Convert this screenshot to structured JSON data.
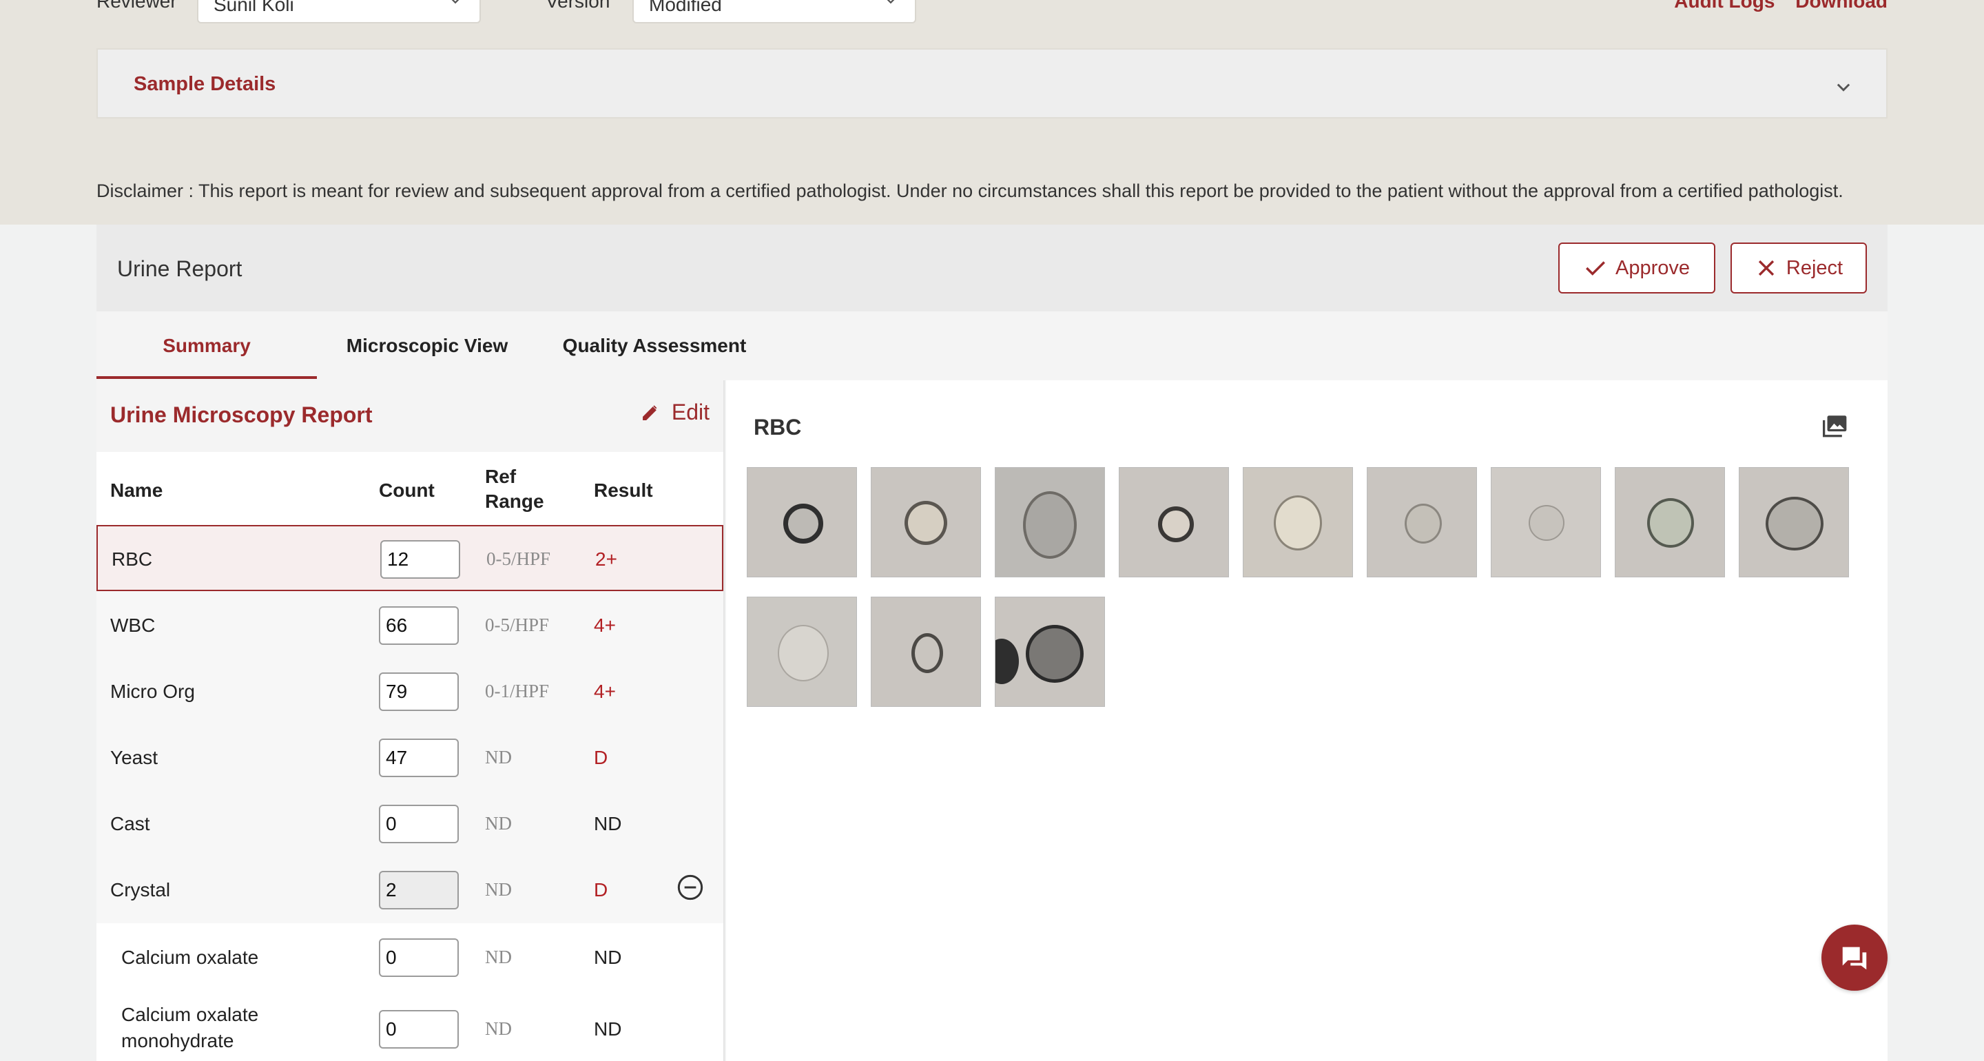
{
  "filters": {
    "reviewer_label": "Reviewer",
    "reviewer_value": "Sunil Koli",
    "version_label": "Version",
    "version_value": "Modified"
  },
  "top_links": {
    "audit_logs": "Audit Logs",
    "download": "Download"
  },
  "sample_details": {
    "title": "Sample Details"
  },
  "disclaimer": "Disclaimer :  This report is meant for review and subsequent approval from a certified pathologist. Under no circumstances shall this report be provided to the patient without the approval from a certified pathologist.",
  "report": {
    "title": "Urine Report",
    "approve_label": "Approve",
    "reject_label": "Reject"
  },
  "tabs": [
    {
      "label": "Summary",
      "active": true
    },
    {
      "label": "Microscopic View",
      "active": false
    },
    {
      "label": "Quality Assessment",
      "active": false
    }
  ],
  "microscopy": {
    "title": "Urine Microscopy Report",
    "edit_label": "Edit",
    "columns": {
      "name": "Name",
      "count": "Count",
      "ref_range_1": "Ref",
      "ref_range_2": "Range",
      "result": "Result"
    },
    "rows": [
      {
        "name": "RBC",
        "count": "12",
        "ref": "0-5/HPF",
        "result": "2+"
      },
      {
        "name": "WBC",
        "count": "66",
        "ref": "0-5/HPF",
        "result": "4+"
      },
      {
        "name": "Micro Org",
        "count": "79",
        "ref": "0-1/HPF",
        "result": "4+"
      },
      {
        "name": "Yeast",
        "count": "47",
        "ref": "ND",
        "result": "D"
      },
      {
        "name": "Cast",
        "count": "0",
        "ref": "ND",
        "result": "ND"
      },
      {
        "name": "Crystal",
        "count": "2",
        "ref": "ND",
        "result": "D"
      },
      {
        "name": "Calcium oxalate",
        "count": "0",
        "ref": "ND",
        "result": "ND"
      },
      {
        "name_line1": "Calcium oxalate",
        "name_line2": "monohydrate",
        "count": "0",
        "ref": "ND",
        "result": "ND"
      }
    ]
  },
  "viewer": {
    "title": "RBC",
    "image_count": 12
  },
  "colors": {
    "accent": "#9b2a2c",
    "result_red": "#b22024",
    "top_band": "#e7e4dd"
  },
  "icons": [
    "chevron-down-icon",
    "check-icon",
    "close-icon",
    "pencil-icon",
    "minus-circle-icon",
    "gallery-icon",
    "chat-icon"
  ]
}
